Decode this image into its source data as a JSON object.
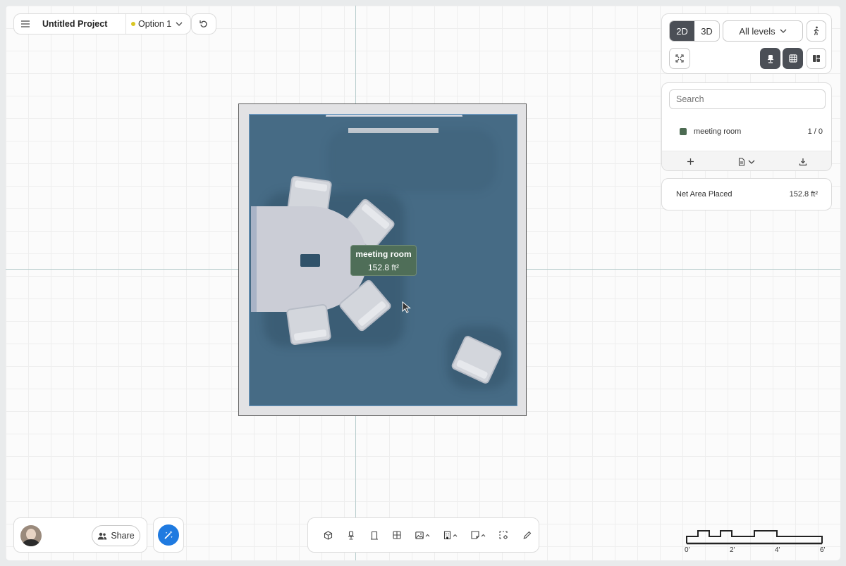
{
  "project": {
    "title": "Untitled Project",
    "option_label": "Option 1",
    "option_color": "#d8c624"
  },
  "view": {
    "mode_2d": "2D",
    "mode_3d": "3D",
    "active_mode": "2D",
    "levels_label": "All levels"
  },
  "search": {
    "placeholder": "Search"
  },
  "spaces": [
    {
      "name": "meeting room",
      "count": "1 / 0",
      "color": "#4c6b52"
    }
  ],
  "summary": {
    "label": "Net Area Placed",
    "value": "152.8 ft²"
  },
  "room": {
    "name": "meeting room",
    "area": "152.8 ft²",
    "floor_color": "#466b85",
    "label_color": "#4f6e58"
  },
  "user": {
    "share_label": "Share"
  },
  "toolbar": {
    "tools": [
      "cube-icon",
      "chair-icon",
      "door-icon",
      "window-icon",
      "image-icon",
      "building-icon",
      "note-icon",
      "select-settings-icon",
      "pencil-icon"
    ]
  },
  "scale": {
    "labels": [
      "0'",
      "2'",
      "4'",
      "6'"
    ]
  }
}
